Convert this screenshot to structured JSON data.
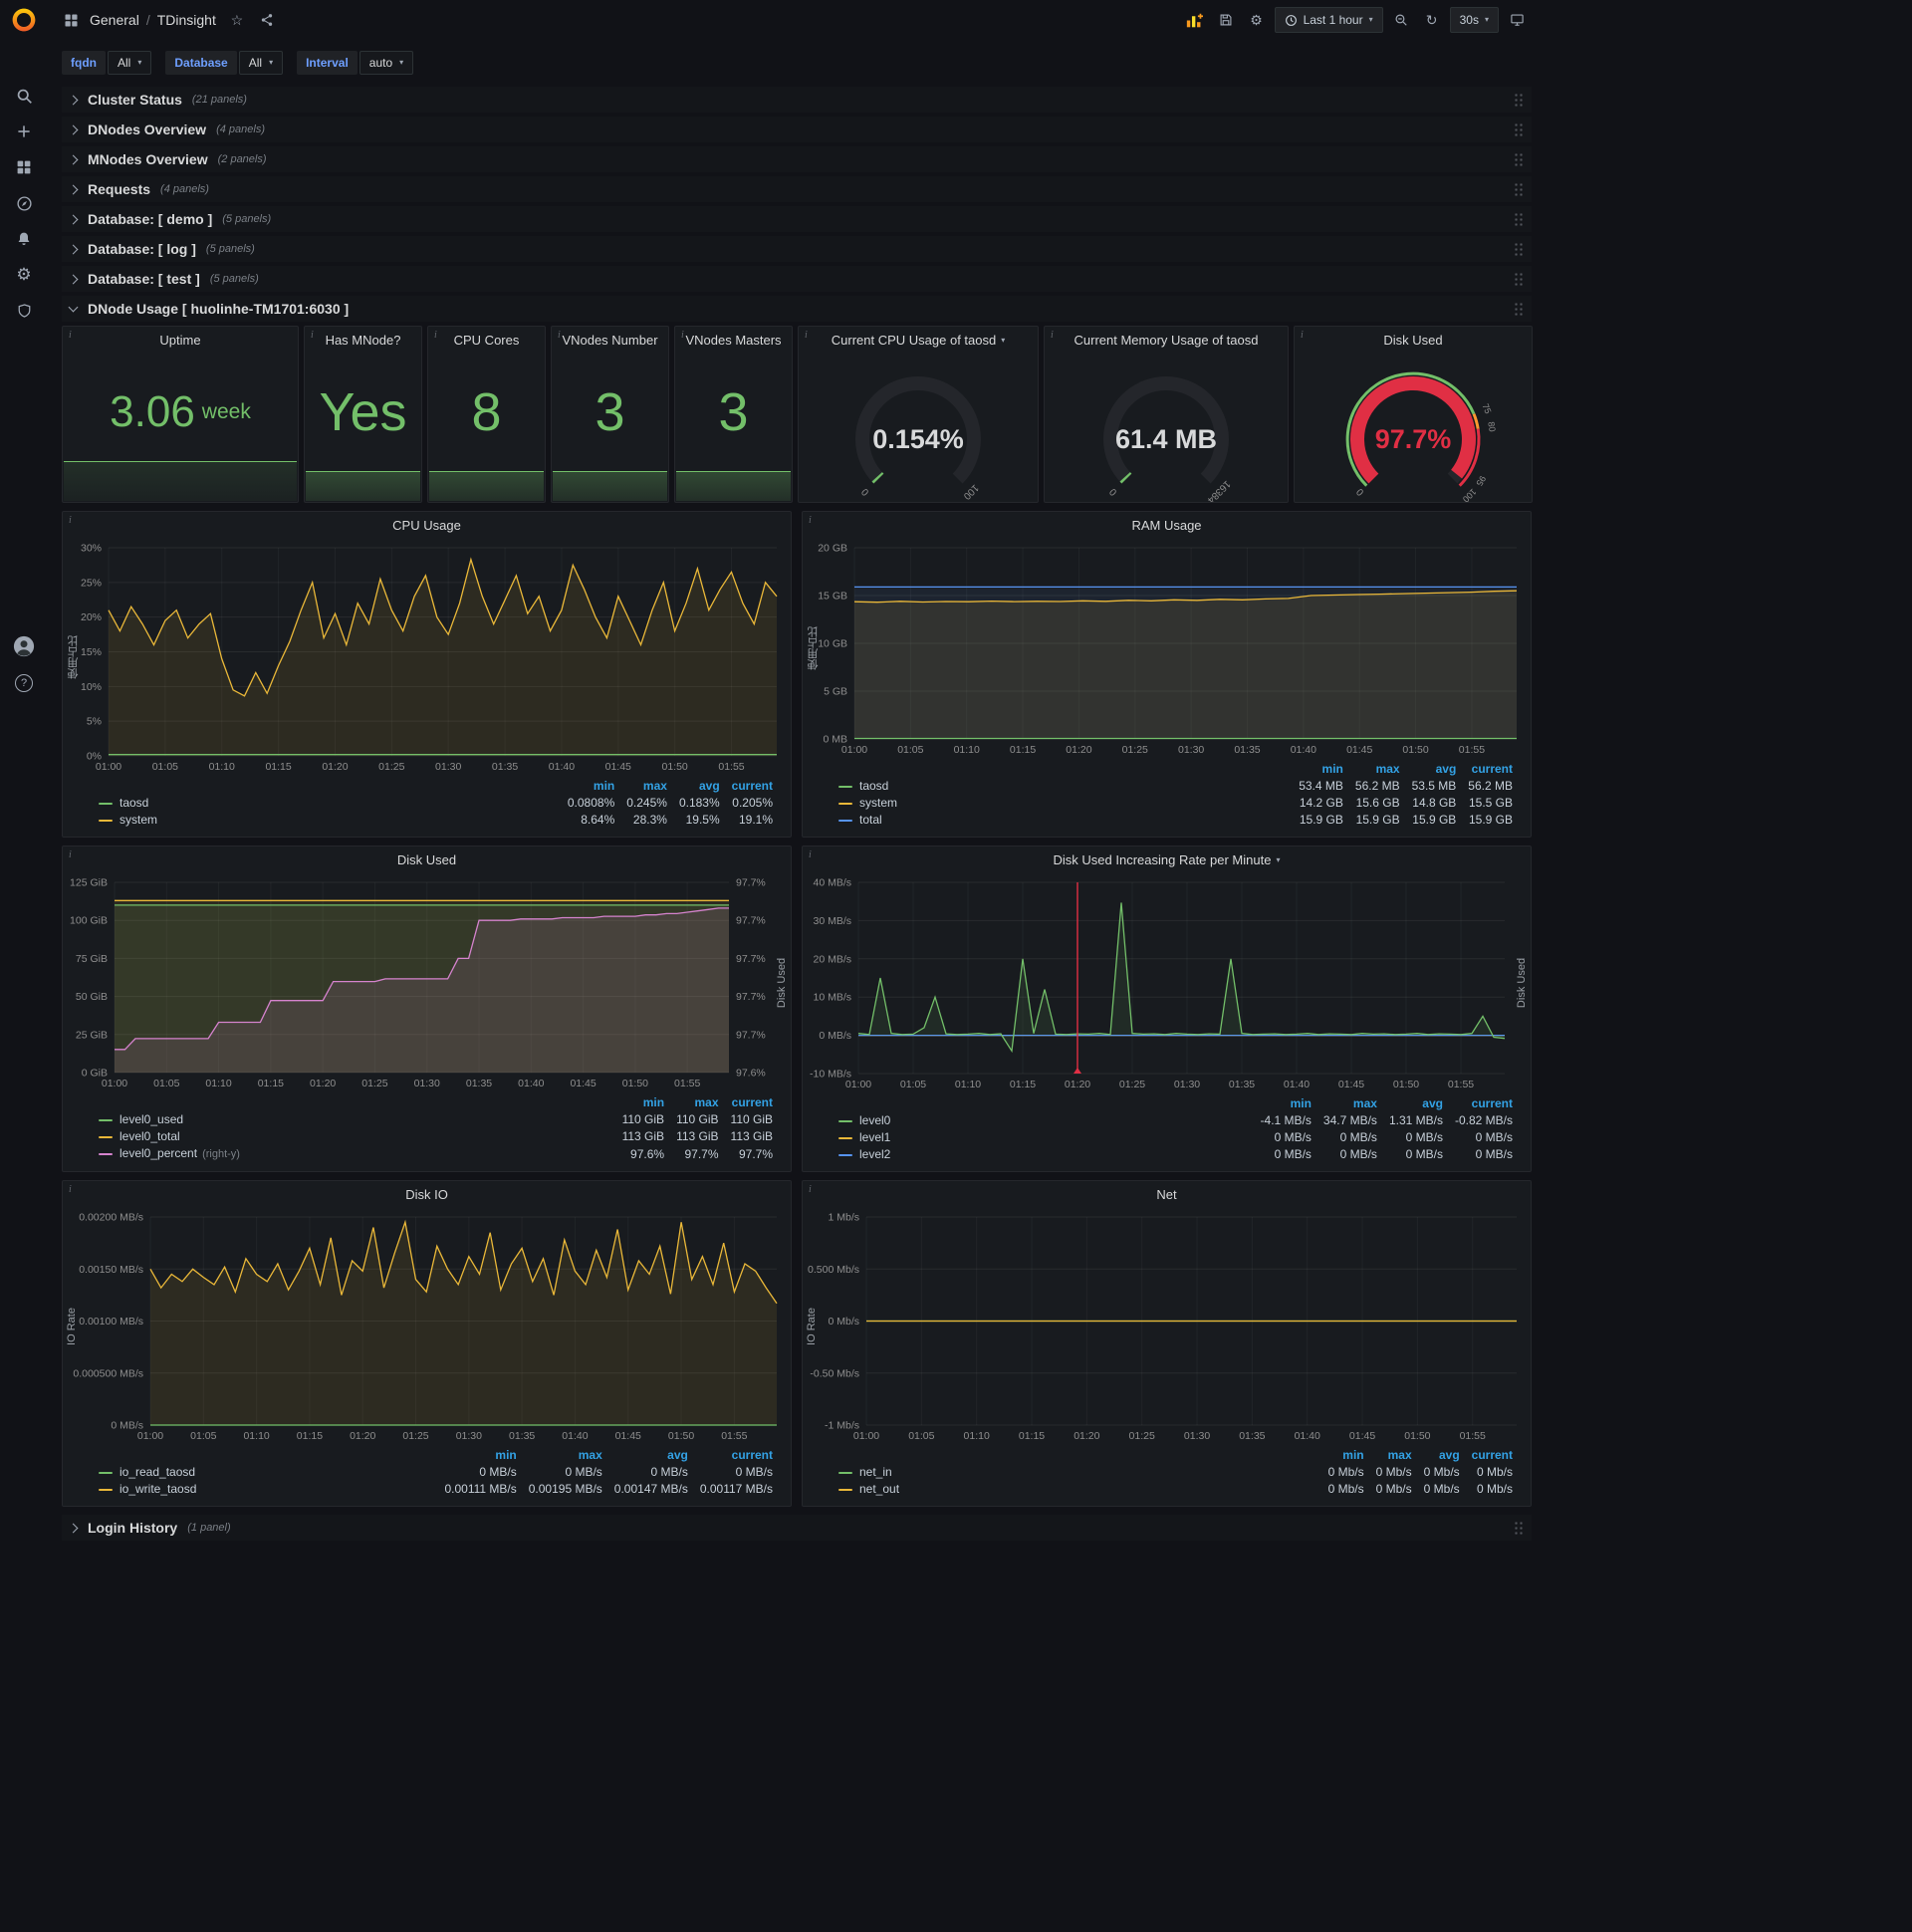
{
  "navbar": {
    "breadcrumb_folder": "General",
    "breadcrumb_sep": "/",
    "breadcrumb_page": "TDinsight",
    "time_range": "Last 1 hour",
    "refresh_interval": "30s"
  },
  "icons": {
    "gear_glyph": "⚙",
    "caret_glyph": "▾",
    "star_glyph": "☆",
    "refresh_glyph": "↻",
    "help_glyph": "?",
    "plus_glyph": "+"
  },
  "variables": [
    {
      "label": "fqdn",
      "value": "All"
    },
    {
      "label": "Database",
      "value": "All"
    },
    {
      "label": "Interval",
      "value": "auto"
    }
  ],
  "rows": [
    {
      "label": "Cluster Status",
      "count": "(21 panels)"
    },
    {
      "label": "DNodes Overview",
      "count": "(4 panels)"
    },
    {
      "label": "MNodes Overview",
      "count": "(2 panels)"
    },
    {
      "label": "Requests",
      "count": "(4 panels)"
    },
    {
      "label": "Database: [ demo ]",
      "count": "(5 panels)"
    },
    {
      "label": "Database: [ log ]",
      "count": "(5 panels)"
    },
    {
      "label": "Database: [ test ]",
      "count": "(5 panels)"
    }
  ],
  "dnode_row": {
    "label": "DNode Usage [ huolinhe-TM1701:6030 ]"
  },
  "footer_row": {
    "label": "Login History",
    "count": "(1 panel)"
  },
  "stats": [
    {
      "title": "Uptime",
      "value": "3.06",
      "unit": "week"
    },
    {
      "title": "Has MNode?",
      "value": "Yes"
    },
    {
      "title": "CPU Cores",
      "value": "8"
    },
    {
      "title": "VNodes Number",
      "value": "3"
    },
    {
      "title": "VNodes Masters",
      "value": "3"
    }
  ],
  "gauges": [
    {
      "title": "Current CPU Usage of taosd",
      "caret": true,
      "value": "0.154%",
      "min_label": "0",
      "max_label": "100",
      "fraction": 0.00154,
      "bar_color": "#73bf69",
      "value_color": "#d8d9da"
    },
    {
      "title": "Current Memory Usage of taosd",
      "value": "61.4 MB",
      "min_label": "0",
      "max_label": "16384",
      "fraction": 0.0037,
      "bar_color": "#73bf69",
      "value_color": "#d8d9da"
    },
    {
      "title": "Disk Used",
      "value": "97.7%",
      "min_label": "0",
      "fraction": 0.977,
      "bar_color": "#e02f44",
      "value_color": "#e02f44",
      "thresholds": [
        {
          "t": 0.75,
          "label": "75"
        },
        {
          "t": 0.8,
          "label": "80"
        },
        {
          "t": 0.95,
          "label": "95"
        },
        {
          "t": 1,
          "label": "100"
        }
      ],
      "outer": [
        {
          "from": 0,
          "to": 0.75,
          "color": "#73bf69"
        },
        {
          "from": 0.75,
          "to": 0.8,
          "color": "#ff9830"
        },
        {
          "from": 0.8,
          "to": 1,
          "color": "#e02f44"
        }
      ]
    }
  ],
  "chart_shared": {
    "x_max": 59,
    "x_ticks": [
      {
        "m": 0,
        "t": "01:00"
      },
      {
        "m": 5,
        "t": "01:05"
      },
      {
        "m": 10,
        "t": "01:10"
      },
      {
        "m": 15,
        "t": "01:15"
      },
      {
        "m": 20,
        "t": "01:20"
      },
      {
        "m": 25,
        "t": "01:25"
      },
      {
        "m": 30,
        "t": "01:30"
      },
      {
        "m": 35,
        "t": "01:35"
      },
      {
        "m": 40,
        "t": "01:40"
      },
      {
        "m": 45,
        "t": "01:45"
      },
      {
        "m": 50,
        "t": "01:50"
      },
      {
        "m": 55,
        "t": "01:55"
      }
    ]
  },
  "chart_data": [
    {
      "type": "line",
      "title": "CPU Usage",
      "ylabel": "使用占比",
      "pad_left": 46,
      "ylim": [
        0,
        30
      ],
      "y_ticks": [
        {
          "v": 0,
          "t": "0%"
        },
        {
          "v": 5,
          "t": "5%"
        },
        {
          "v": 10,
          "t": "10%"
        },
        {
          "v": 15,
          "t": "15%"
        },
        {
          "v": 20,
          "t": "20%"
        },
        {
          "v": 25,
          "t": "25%"
        },
        {
          "v": 30,
          "t": "30%"
        }
      ],
      "series": [
        {
          "name": "system",
          "color": "#eab839",
          "fill": 0.1,
          "values": [
            21,
            18,
            21.5,
            19,
            16,
            19.5,
            21,
            17,
            19,
            20.5,
            14,
            9.5,
            8.64,
            12,
            9,
            13,
            16.5,
            21,
            25,
            17,
            20.5,
            16,
            22,
            19,
            25.5,
            21,
            18,
            23,
            26,
            20,
            17.5,
            22,
            28.3,
            23,
            19,
            22.5,
            26,
            20.5,
            23,
            18,
            21,
            27.5,
            24,
            20,
            17,
            23,
            19.5,
            16,
            21,
            25,
            18,
            22,
            27,
            21,
            24,
            26.5,
            22,
            19,
            25,
            23
          ]
        },
        {
          "name": "taosd",
          "color": "#73bf69",
          "fill": 0.1,
          "const": 0.2
        }
      ],
      "legend": {
        "columns": [
          "min",
          "max",
          "avg",
          "current"
        ],
        "rows": [
          {
            "name": "taosd",
            "color": "#73bf69",
            "values": [
              "0.0808%",
              "0.245%",
              "0.183%",
              "0.205%"
            ]
          },
          {
            "name": "system",
            "color": "#eab839",
            "values": [
              "8.64%",
              "28.3%",
              "19.5%",
              "19.1%"
            ]
          }
        ]
      }
    },
    {
      "type": "line",
      "title": "RAM Usage",
      "ylabel": "使用占比",
      "pad_left": 52,
      "ylim": [
        0,
        20
      ],
      "y_ticks": [
        {
          "v": 0,
          "t": "0 MB"
        },
        {
          "v": 5,
          "t": "5 GB"
        },
        {
          "v": 10,
          "t": "10 GB"
        },
        {
          "v": 15,
          "t": "15 GB"
        },
        {
          "v": 20,
          "t": "20 GB"
        }
      ],
      "series": [
        {
          "name": "total",
          "color": "#5794f2",
          "fill": 0.08,
          "const": 15.9
        },
        {
          "name": "system",
          "color": "#eab839",
          "fill": 0.1,
          "values": [
            14.35,
            14.3,
            14.4,
            14.32,
            14.38,
            14.35,
            14.42,
            14.36,
            14.4,
            14.38,
            14.45,
            14.4,
            14.5,
            14.45,
            14.55,
            14.5,
            14.6,
            14.55,
            14.65,
            14.7,
            15.0,
            15.05,
            15.1,
            15.15,
            15.2,
            15.25,
            15.3,
            15.35,
            15.45,
            15.5
          ]
        },
        {
          "name": "taosd",
          "color": "#73bf69",
          "fill": 0.1,
          "const": 0.055
        }
      ],
      "legend": {
        "columns": [
          "min",
          "max",
          "avg",
          "current"
        ],
        "rows": [
          {
            "name": "taosd",
            "color": "#73bf69",
            "values": [
              "53.4 MB",
              "56.2 MB",
              "53.5 MB",
              "56.2 MB"
            ]
          },
          {
            "name": "system",
            "color": "#eab839",
            "values": [
              "14.2 GB",
              "15.6 GB",
              "14.8 GB",
              "15.5 GB"
            ]
          },
          {
            "name": "total",
            "color": "#5794f2",
            "values": [
              "15.9 GB",
              "15.9 GB",
              "15.9 GB",
              "15.9 GB"
            ]
          }
        ]
      }
    },
    {
      "type": "line",
      "title": "Disk Used",
      "pad_left": 52,
      "pad_right": 62,
      "ylim": [
        0,
        125
      ],
      "y_ticks": [
        {
          "v": 0,
          "t": "0 GiB"
        },
        {
          "v": 25,
          "t": "25 GiB"
        },
        {
          "v": 50,
          "t": "50 GiB"
        },
        {
          "v": 75,
          "t": "75 GiB"
        },
        {
          "v": 100,
          "t": "100 GiB"
        },
        {
          "v": 125,
          "t": "125 GiB"
        }
      ],
      "right_ylim": [
        97.58,
        97.72
      ],
      "right_ticks": [
        "97.6%",
        "97.7%",
        "97.7%",
        "97.7%",
        "97.7%",
        "97.7%"
      ],
      "right_label": "Disk Used",
      "series": [
        {
          "name": "level0_total",
          "color": "#eab839",
          "fill": 0.1,
          "const": 113
        },
        {
          "name": "level0_used",
          "color": "#73bf69",
          "fill": 0.1,
          "const": 110
        },
        {
          "name": "level0_percent",
          "color": "#d683ce",
          "fill": 0.12,
          "axis": "right",
          "values": [
            97.597,
            97.597,
            97.605,
            97.605,
            97.605,
            97.605,
            97.605,
            97.605,
            97.605,
            97.605,
            97.617,
            97.617,
            97.617,
            97.617,
            97.617,
            97.633,
            97.633,
            97.633,
            97.633,
            97.633,
            97.633,
            97.647,
            97.647,
            97.647,
            97.647,
            97.647,
            97.649,
            97.649,
            97.649,
            97.649,
            97.649,
            97.649,
            97.649,
            97.664,
            97.664,
            97.692,
            97.692,
            97.692,
            97.692,
            97.693,
            97.693,
            97.693,
            97.693,
            97.694,
            97.694,
            97.694,
            97.694,
            97.695,
            97.695,
            97.695,
            97.695,
            97.696,
            97.696,
            97.697,
            97.697,
            97.698,
            97.699,
            97.7,
            97.701,
            97.701
          ]
        }
      ],
      "legend": {
        "columns": [
          "min",
          "max",
          "current"
        ],
        "rows": [
          {
            "name": "level0_used",
            "color": "#73bf69",
            "values": [
              "110 GiB",
              "110 GiB",
              "110 GiB"
            ]
          },
          {
            "name": "level0_total",
            "color": "#eab839",
            "values": [
              "113 GiB",
              "113 GiB",
              "113 GiB"
            ]
          },
          {
            "name": "level0_percent",
            "color": "#d683ce",
            "suffix": "(right-y)",
            "values": [
              "97.6%",
              "97.7%",
              "97.7%"
            ]
          }
        ]
      }
    },
    {
      "type": "line",
      "title": "Disk Used Increasing Rate per Minute",
      "caret": true,
      "pad_left": 56,
      "pad_right": 26,
      "ylim": [
        -10,
        40
      ],
      "y_ticks": [
        {
          "v": -10,
          "t": "-10 MB/s"
        },
        {
          "v": 0,
          "t": "0 MB/s"
        },
        {
          "v": 10,
          "t": "10 MB/s"
        },
        {
          "v": 20,
          "t": "20 MB/s"
        },
        {
          "v": 30,
          "t": "30 MB/s"
        },
        {
          "v": 40,
          "t": "40 MB/s"
        }
      ],
      "right_label": "Disk Used",
      "annotation_minute": 20,
      "series": [
        {
          "name": "level1",
          "color": "#eab839",
          "fill": 0,
          "const": 0
        },
        {
          "name": "level2",
          "color": "#5794f2",
          "fill": 0,
          "const": 0
        },
        {
          "name": "level0",
          "color": "#73bf69",
          "fill": 0.1,
          "values": [
            0.5,
            0.2,
            15,
            0.5,
            0.2,
            0.3,
            2,
            10,
            0.4,
            0.2,
            0.3,
            0.5,
            0.2,
            0.4,
            -4.1,
            20,
            0.5,
            12,
            0.3,
            0.2,
            0.4,
            0.3,
            0.5,
            0.2,
            34.7,
            0.5,
            0.3,
            0.4,
            0.2,
            0.5,
            0.3,
            0.2,
            0.4,
            0.3,
            20,
            0.5,
            0.2,
            0.3,
            0.4,
            0.2,
            0.3,
            0.5,
            0.2,
            0.4,
            0.3,
            0.2,
            0.5,
            0.3,
            0.4,
            0.2,
            0.3,
            0.5,
            0.2,
            0.4,
            0.3,
            0.2,
            0.5,
            5,
            -0.5,
            -0.82
          ]
        }
      ],
      "legend": {
        "columns": [
          "min",
          "max",
          "avg",
          "current"
        ],
        "rows": [
          {
            "name": "level0",
            "color": "#73bf69",
            "values": [
              "-4.1 MB/s",
              "34.7 MB/s",
              "1.31 MB/s",
              "-0.82 MB/s"
            ]
          },
          {
            "name": "level1",
            "color": "#eab839",
            "values": [
              "0 MB/s",
              "0 MB/s",
              "0 MB/s",
              "0 MB/s"
            ]
          },
          {
            "name": "level2",
            "color": "#5794f2",
            "values": [
              "0 MB/s",
              "0 MB/s",
              "0 MB/s",
              "0 MB/s"
            ]
          }
        ]
      }
    },
    {
      "type": "line",
      "title": "Disk IO",
      "ylabel": "IO Rate",
      "pad_left": 88,
      "ylim": [
        0,
        0.002
      ],
      "y_ticks": [
        {
          "v": 0,
          "t": "0 MB/s"
        },
        {
          "v": 0.0005,
          "t": "0.000500 MB/s"
        },
        {
          "v": 0.001,
          "t": "0.00100 MB/s"
        },
        {
          "v": 0.0015,
          "t": "0.00150 MB/s"
        },
        {
          "v": 0.002,
          "t": "0.00200 MB/s"
        }
      ],
      "series": [
        {
          "name": "io_write_taosd",
          "color": "#eab839",
          "fill": 0.1,
          "values": [
            0.0015,
            0.00132,
            0.00145,
            0.00138,
            0.0015,
            0.00142,
            0.00135,
            0.00152,
            0.00128,
            0.0016,
            0.00145,
            0.00138,
            0.00155,
            0.0013,
            0.00148,
            0.0017,
            0.00135,
            0.0018,
            0.00125,
            0.00158,
            0.00148,
            0.0019,
            0.00132,
            0.00165,
            0.00195,
            0.0014,
            0.00128,
            0.00172,
            0.0015,
            0.00135,
            0.00162,
            0.00145,
            0.00185,
            0.0013,
            0.00155,
            0.0017,
            0.00138,
            0.0016,
            0.00125,
            0.00178,
            0.00148,
            0.00135,
            0.00168,
            0.00142,
            0.00188,
            0.0013,
            0.00158,
            0.00145,
            0.00172,
            0.00126,
            0.00195,
            0.0014,
            0.00162,
            0.00135,
            0.00175,
            0.00128,
            0.00155,
            0.00148,
            0.00132,
            0.00117
          ]
        },
        {
          "name": "io_read_taosd",
          "color": "#73bf69",
          "fill": 0,
          "const": 0
        }
      ],
      "legend": {
        "columns": [
          "min",
          "max",
          "avg",
          "current"
        ],
        "rows": [
          {
            "name": "io_read_taosd",
            "color": "#73bf69",
            "values": [
              "0 MB/s",
              "0 MB/s",
              "0 MB/s",
              "0 MB/s"
            ]
          },
          {
            "name": "io_write_taosd",
            "color": "#eab839",
            "values": [
              "0.00111 MB/s",
              "0.00195 MB/s",
              "0.00147 MB/s",
              "0.00117 MB/s"
            ]
          }
        ]
      }
    },
    {
      "type": "line",
      "title": "Net",
      "ylabel": "IO Rate",
      "pad_left": 64,
      "ylim": [
        -1,
        1
      ],
      "y_ticks": [
        {
          "v": -1,
          "t": "-1 Mb/s"
        },
        {
          "v": -0.5,
          "t": "-0.50 Mb/s"
        },
        {
          "v": 0,
          "t": "0 Mb/s"
        },
        {
          "v": 0.5,
          "t": "0.500 Mb/s"
        },
        {
          "v": 1,
          "t": "1 Mb/s"
        }
      ],
      "series": [
        {
          "name": "net_in",
          "color": "#73bf69",
          "fill": 0,
          "const": 0
        },
        {
          "name": "net_out",
          "color": "#eab839",
          "fill": 0,
          "const": 0
        }
      ],
      "legend": {
        "columns": [
          "min",
          "max",
          "avg",
          "current"
        ],
        "rows": [
          {
            "name": "net_in",
            "color": "#73bf69",
            "values": [
              "0 Mb/s",
              "0 Mb/s",
              "0 Mb/s",
              "0 Mb/s"
            ]
          },
          {
            "name": "net_out",
            "color": "#eab839",
            "values": [
              "0 Mb/s",
              "0 Mb/s",
              "0 Mb/s",
              "0 Mb/s"
            ]
          }
        ]
      }
    }
  ],
  "colors": {
    "green": "#73bf69",
    "yellow": "#eab839",
    "blue": "#5794f2",
    "pink": "#d683ce",
    "red": "#e02f44",
    "orange": "#ff9830"
  }
}
